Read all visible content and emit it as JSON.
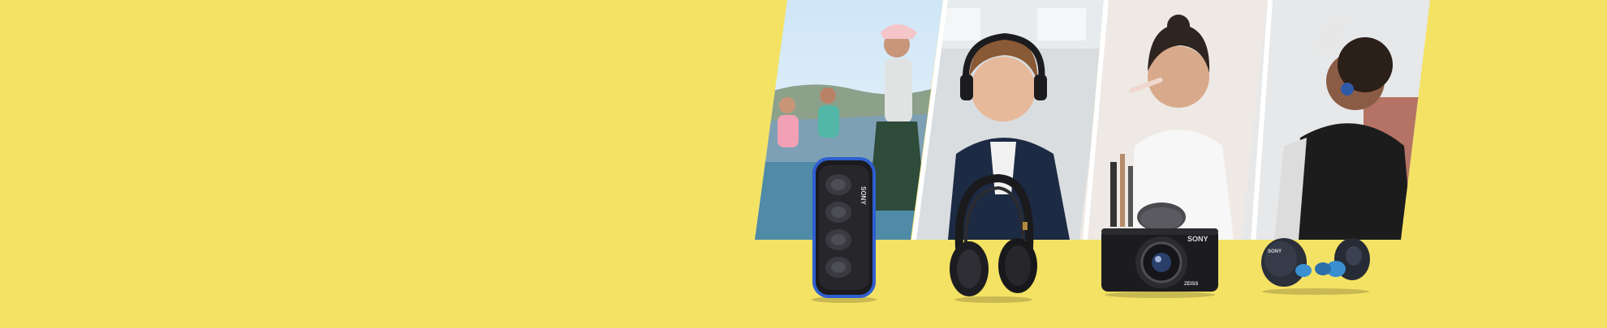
{
  "banner": {
    "background": "#f4e264",
    "panels": [
      {
        "scene": "friends-poolside-party",
        "product": "portable-speaker"
      },
      {
        "scene": "man-listening-headphones-train",
        "product": "over-ear-headphones"
      },
      {
        "scene": "woman-makeup-vlog",
        "product": "compact-camera"
      },
      {
        "scene": "woman-dancing-earbuds",
        "product": "wireless-earbuds"
      }
    ],
    "speaker_brand": "SONY",
    "camera_brand": "SONY",
    "camera_lens_text": "ZEISS",
    "earbud_brand": "SONY"
  }
}
